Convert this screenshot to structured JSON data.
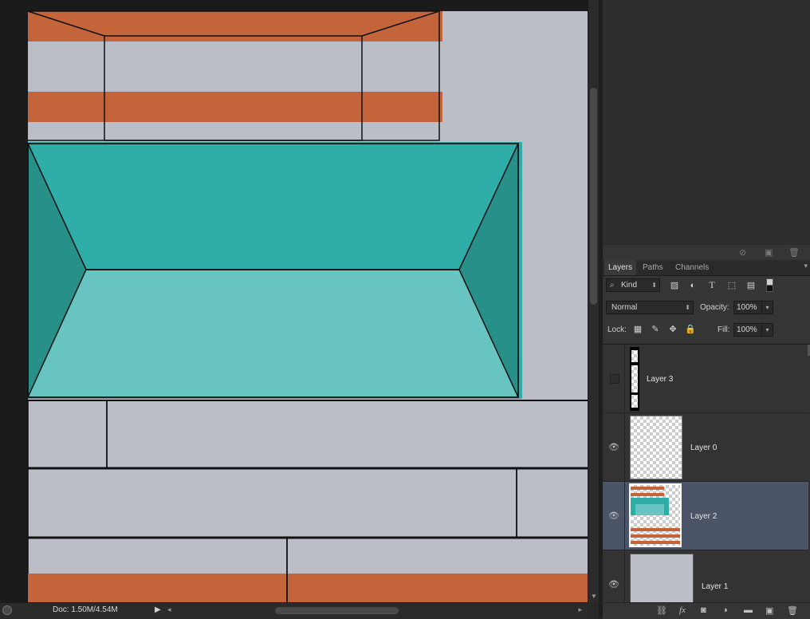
{
  "status_bar": {
    "doc_info": "Doc: 1.50M/4.54M"
  },
  "colors": {
    "canvas_bg": "#bcbec7",
    "orange": "#c3643b",
    "teal_dark": "#2fada8",
    "teal_side": "#279089",
    "teal_light": "#67c4c1",
    "outline": "#101010",
    "selected_row": "#4c5467"
  },
  "panel": {
    "tabs": [
      {
        "label": "Layers",
        "active": true
      },
      {
        "label": "Paths",
        "active": false
      },
      {
        "label": "Channels",
        "active": false
      }
    ],
    "kind_filter": "Kind",
    "blend_mode": "Normal",
    "opacity_label": "Opacity:",
    "opacity_value": "100%",
    "lock_label": "Lock:",
    "fill_label": "Fill:",
    "fill_value": "100%",
    "layers": [
      {
        "name": "Layer 3",
        "visible": false,
        "selected": false
      },
      {
        "name": "Layer 0",
        "visible": true,
        "selected": false
      },
      {
        "name": "Layer 2",
        "visible": true,
        "selected": true
      },
      {
        "name": "Layer 1",
        "visible": true,
        "selected": false
      }
    ]
  }
}
